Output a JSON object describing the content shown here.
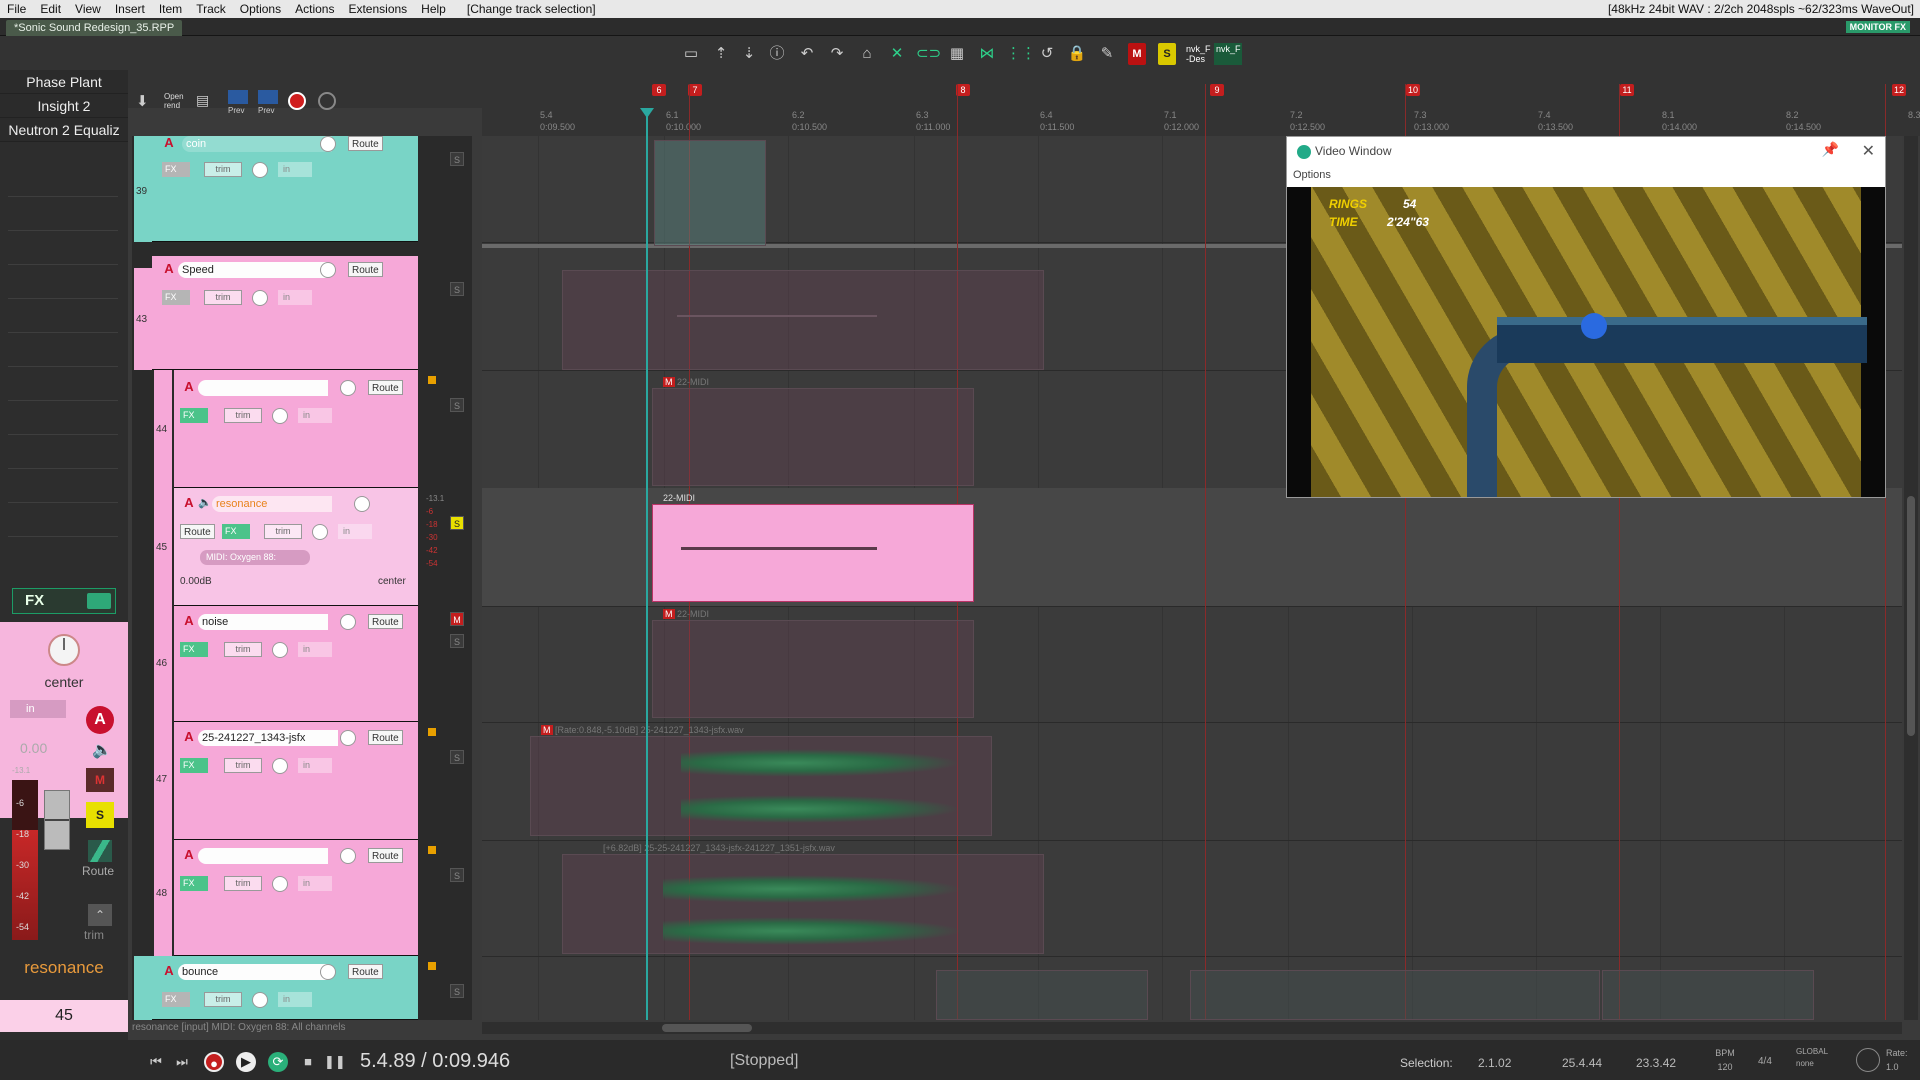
{
  "menu": {
    "items": [
      "File",
      "Edit",
      "View",
      "Insert",
      "Item",
      "Track",
      "Options",
      "Actions",
      "Extensions",
      "Help"
    ],
    "status": "[Change track selection]",
    "audio_info": "[48kHz 24bit WAV : 2/2ch 2048spls ~62/323ms WaveOut]"
  },
  "project_tab": "*Sonic Sound Redesign_35.RPP",
  "monitor_fx": "MONITOR FX",
  "toolbar_nvk1": "nvk_F -Des",
  "toolbar_nvk2": "nvk_F",
  "toolbar_m": "M",
  "toolbar_s": "S",
  "fx_chain": [
    "Phase Plant",
    "Insight 2",
    "Neutron 2 Equaliz"
  ],
  "secondary_toolbar": {
    "open_label": "Open rend",
    "prev1": "Prev",
    "prev2": "Prev"
  },
  "ruler": {
    "markers": [
      "6",
      "7",
      "8",
      "9",
      "10",
      "11",
      "12"
    ],
    "ticks": [
      "5.4",
      "6.1",
      "6.2",
      "6.3",
      "6.4",
      "7.1",
      "7.2",
      "7.3",
      "7.4",
      "8.1",
      "8.2",
      "8.3"
    ],
    "times": [
      "0:09.500",
      "0:10.000",
      "0:10.500",
      "0:11.000",
      "0:11.500",
      "0:12.000",
      "0:12.500",
      "0:13.000",
      "0:13.500",
      "0:14.000",
      "0:14.500"
    ]
  },
  "mixer": {
    "fx_label": "FX",
    "pan_label": "center",
    "input_label": "in",
    "arm_label": "A",
    "volume": "0.00",
    "meter_top": "-13.1",
    "meter_scale": [
      "-6",
      "-18",
      "-30",
      "-42",
      "-54"
    ],
    "mute_label": "M",
    "solo_label": "S",
    "route_label": "Route",
    "trim_label": "trim",
    "track_name": "resonance",
    "track_number": "45"
  },
  "tracks": [
    {
      "num": "39",
      "name": "coin",
      "route": "Route",
      "trim": "trim",
      "fx": "FX",
      "in": "in"
    },
    {
      "num": "43",
      "name": "Speed",
      "route": "Route",
      "trim": "trim",
      "fx": "FX",
      "in": "in"
    },
    {
      "num": "44",
      "name": "",
      "route": "Route",
      "trim": "trim",
      "fx": "FX",
      "in": "in"
    },
    {
      "num": "45",
      "name": "resonance",
      "route": "Route",
      "trim": "trim",
      "fx": "FX",
      "in": "in",
      "midi_input": "MIDI: Oxygen 88:",
      "volume": "0.00dB",
      "pan": "center"
    },
    {
      "num": "46",
      "name": "noise",
      "route": "Route",
      "trim": "trim",
      "fx": "FX",
      "in": "in"
    },
    {
      "num": "47",
      "name": "25-241227_1343-jsfx",
      "route": "Route",
      "trim": "trim",
      "fx": "FX",
      "in": "in"
    },
    {
      "num": "48",
      "name": "",
      "route": "Route",
      "trim": "trim",
      "fx": "FX",
      "in": "in"
    },
    {
      "num": "",
      "name": "bounce",
      "route": "Route",
      "trim": "trim",
      "fx": "FX",
      "in": "in"
    }
  ],
  "track_meter_top": "-13.1",
  "track_meter_scale": [
    "-6",
    "-18",
    "-30",
    "-42",
    "-54"
  ],
  "ms": {
    "m": "M",
    "s": "S"
  },
  "items": {
    "midi1": "22-MIDI",
    "midi2": "22-MIDI",
    "midi3": "22-MIDI",
    "wav1": "[Rate:0.848,-5.10dB] 25-241227_1343-jsfx.wav",
    "wav2": "[+6.82dB] 25-25-241227_1343-jsfx-241227_1351-jsfx.wav",
    "item_m": "M"
  },
  "video_window": {
    "title": "Video Window",
    "options": "Options",
    "rings_label": "RINGS",
    "rings_value": "54",
    "time_label": "TIME",
    "time_value": "2'24\"63"
  },
  "track_info": "resonance [input] MIDI: Oxygen 88: All channels",
  "transport": {
    "position": "5.4.89 / 0:09.946",
    "state": "[Stopped]",
    "selection_label": "Selection:",
    "sel_start": "2.1.02",
    "sel_end": "25.4.44",
    "sel_len": "23.3.42",
    "bpm_label": "BPM",
    "bpm": "120",
    "timesig": "4/4",
    "global_label": "GLOBAL",
    "global_value": "none",
    "rate_label": "Rate:",
    "rate": "1.0"
  }
}
